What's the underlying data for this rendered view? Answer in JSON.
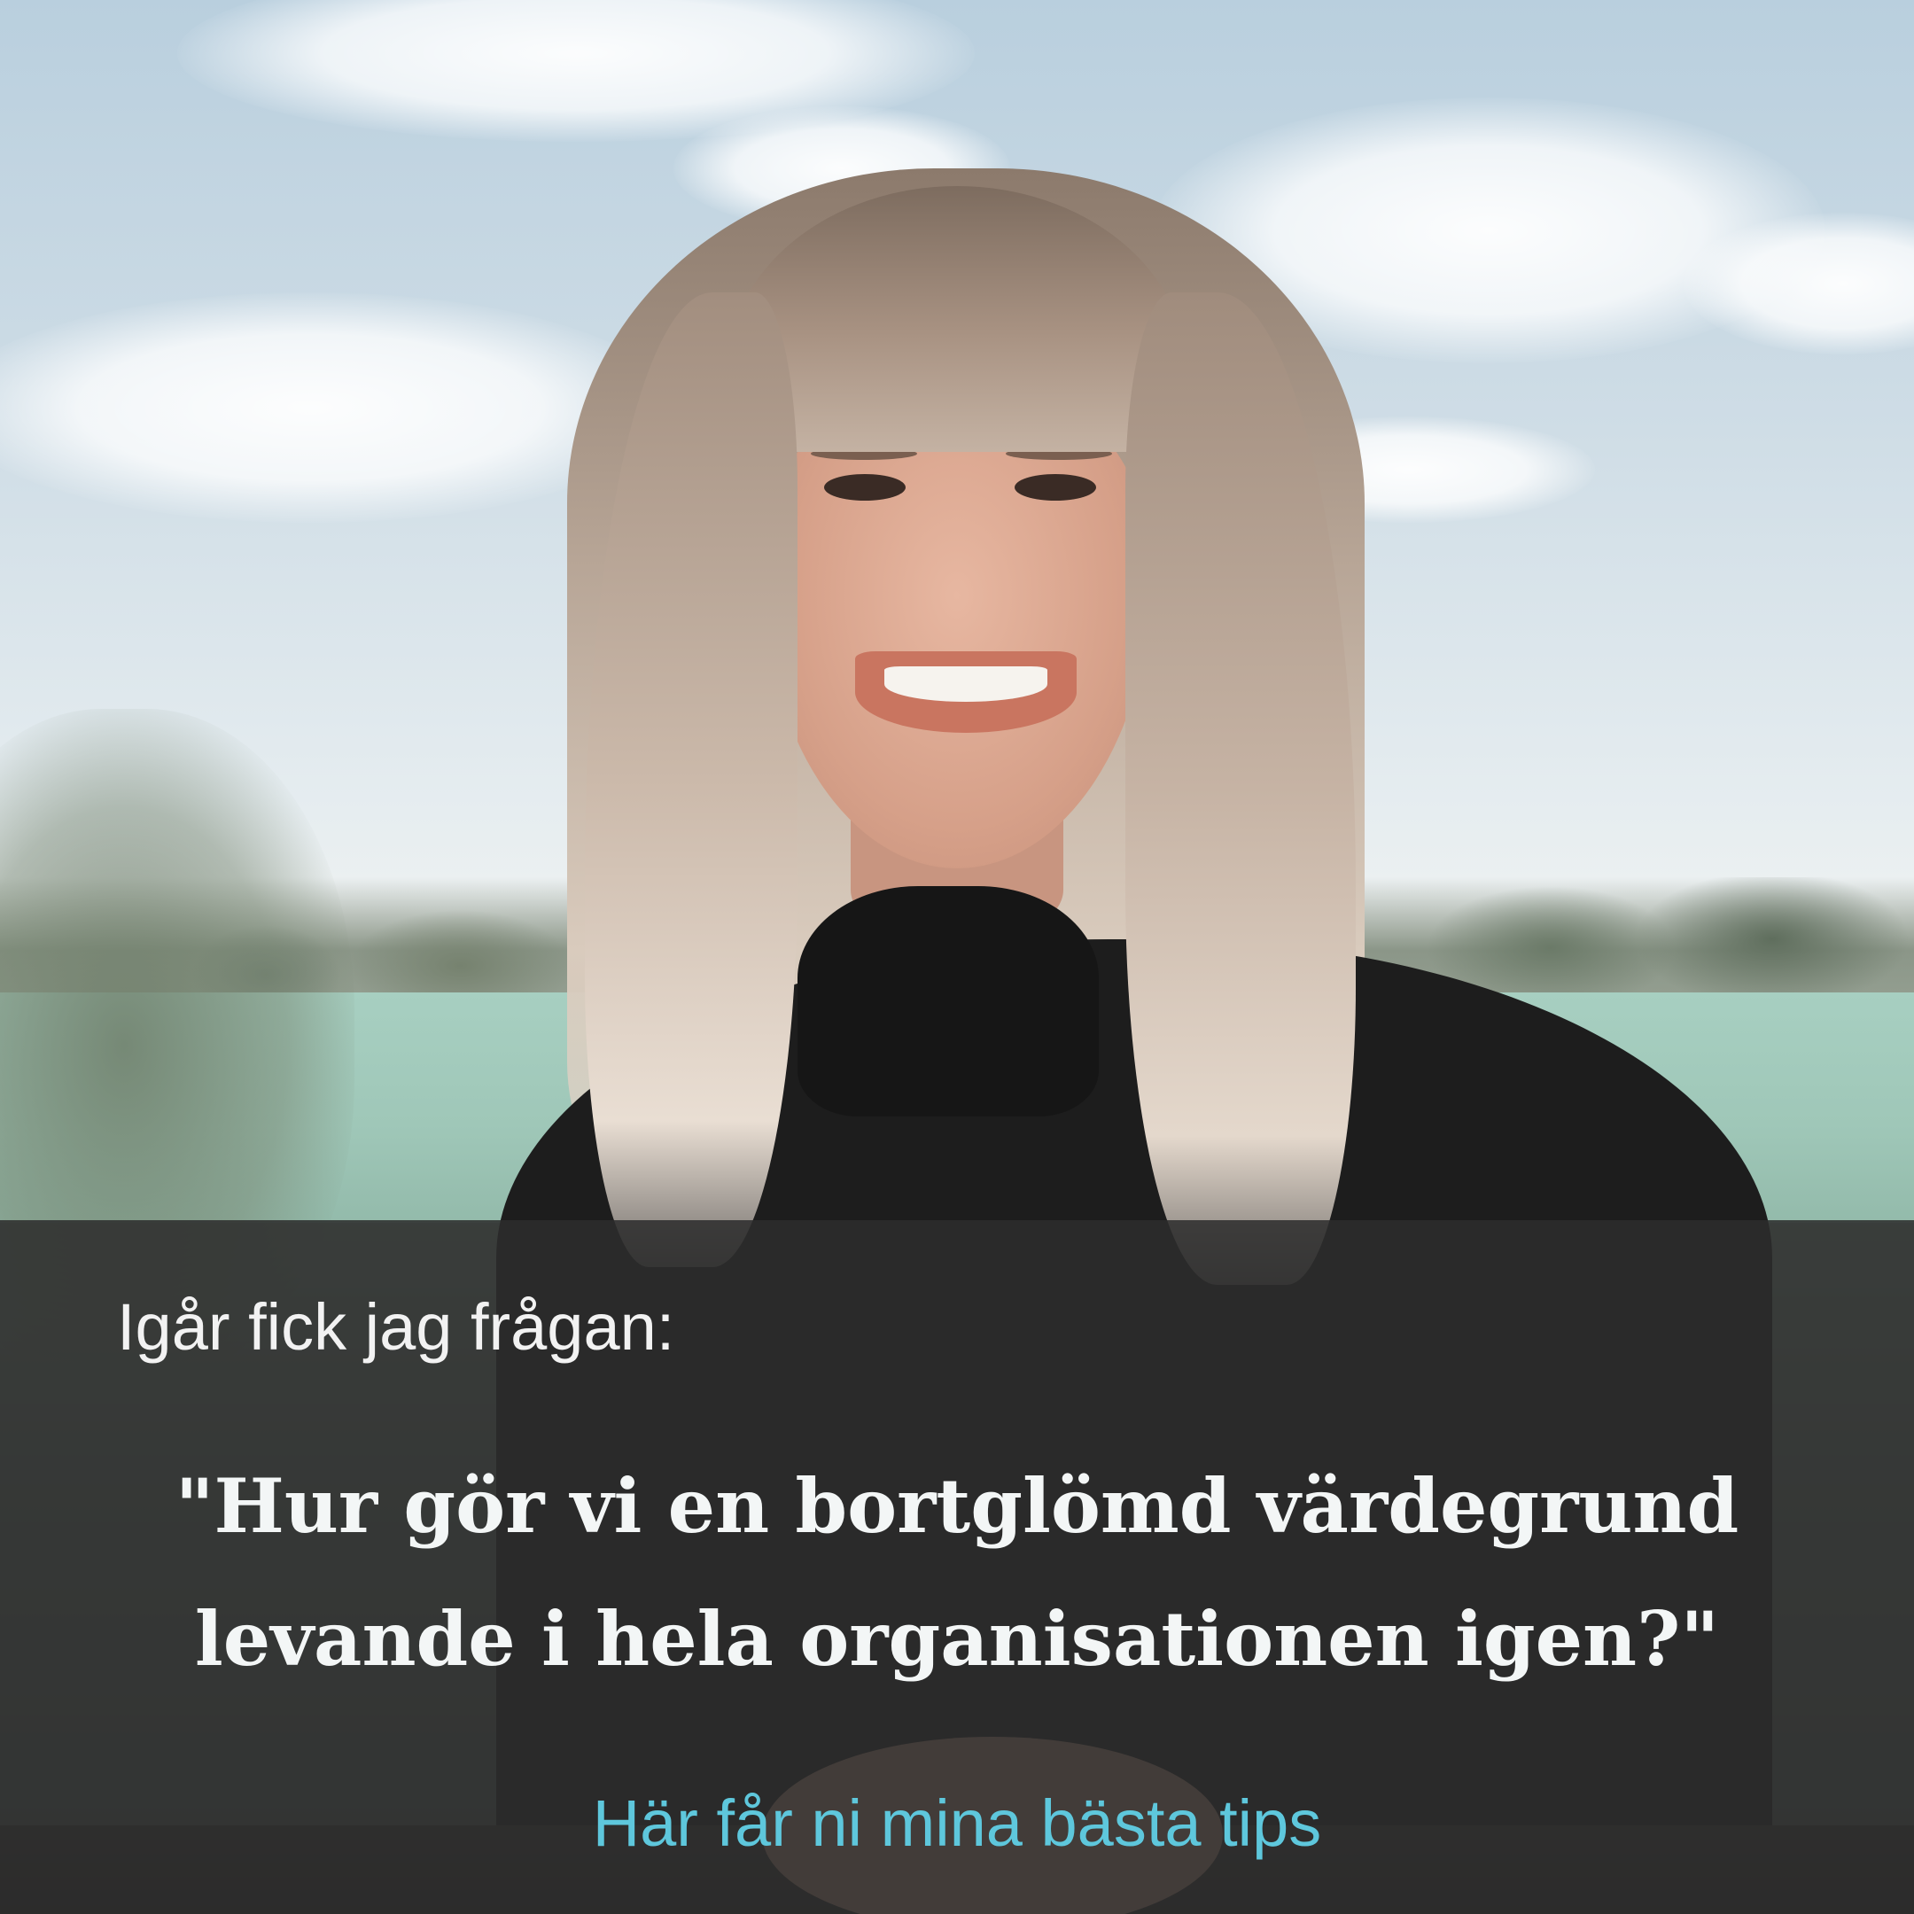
{
  "post": {
    "intro": "Igår fick jag frågan:",
    "quote_line_1": "\"Hur gör vi en bortglömd värdegrund",
    "quote_line_2": "levande i hela organisationen igen?\"",
    "call_to_action": "Här får ni mina bästa tips"
  },
  "colors": {
    "overlay": "#2c2c2c",
    "text_primary": "#f3f6f6",
    "accent": "#5ec7dc"
  }
}
